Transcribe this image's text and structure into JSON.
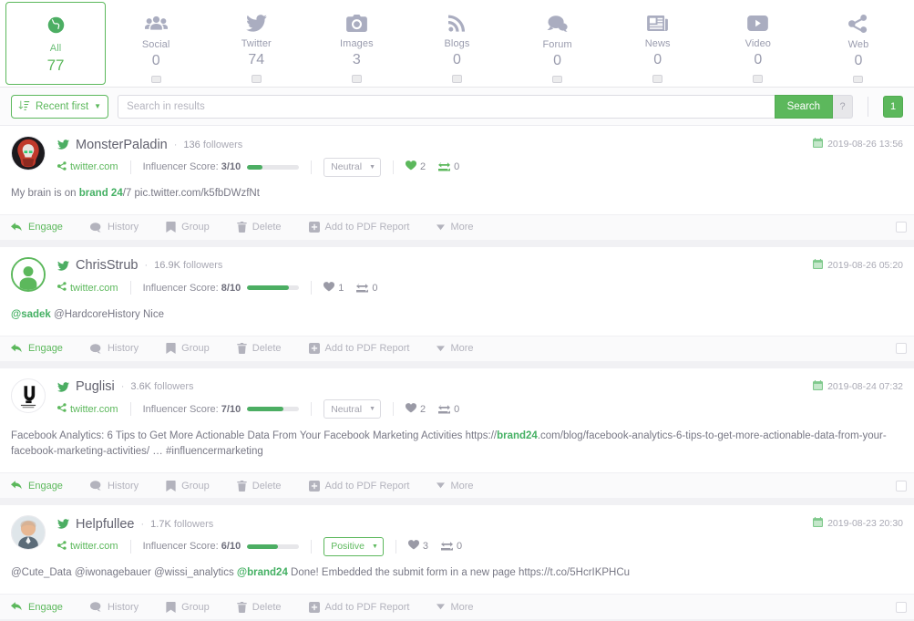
{
  "sources": {
    "items": [
      {
        "label": "All",
        "count": "77",
        "icon": "globe-icon",
        "active": true,
        "checkbox": false
      },
      {
        "label": "Social",
        "count": "0",
        "icon": "users-icon",
        "active": false,
        "checkbox": true
      },
      {
        "label": "Twitter",
        "count": "74",
        "icon": "twitter-icon",
        "active": false,
        "checkbox": true
      },
      {
        "label": "Images",
        "count": "3",
        "icon": "camera-icon",
        "active": false,
        "checkbox": true
      },
      {
        "label": "Blogs",
        "count": "0",
        "icon": "rss-icon",
        "active": false,
        "checkbox": true
      },
      {
        "label": "Forum",
        "count": "0",
        "icon": "comment-icon",
        "active": false,
        "checkbox": true
      },
      {
        "label": "News",
        "count": "0",
        "icon": "news-icon",
        "active": false,
        "checkbox": true
      },
      {
        "label": "Video",
        "count": "0",
        "icon": "video-icon",
        "active": false,
        "checkbox": true
      },
      {
        "label": "Web",
        "count": "0",
        "icon": "share-icon",
        "active": false,
        "checkbox": true
      }
    ]
  },
  "toolbar": {
    "sort_label": "Recent first",
    "search_placeholder": "Search in results",
    "search_value": "",
    "search_button": "Search",
    "help_button": "?",
    "page_button": "1"
  },
  "actions": {
    "engage": "Engage",
    "history": "History",
    "group": "Group",
    "delete": "Delete",
    "pdf": "Add to PDF Report",
    "more": "More"
  },
  "labels": {
    "source_domain": "twitter.com",
    "score_prefix": "Influencer Score:",
    "followers_suffix": "followers",
    "separator_dot": "·"
  },
  "results": [
    {
      "author": "MonsterPaladin",
      "followers": "136",
      "score_text": "3/10",
      "score_pct": 30,
      "sentiment": "Neutral",
      "sentiment_positive": false,
      "likes": "2",
      "retweets": "0",
      "likes_active": true,
      "date": "2019-08-26 13:56",
      "avatar_type": "image-red",
      "text_parts": [
        {
          "t": "My brain is on ",
          "style": "plain"
        },
        {
          "t": "brand 24",
          "style": "hl"
        },
        {
          "t": "/7 pic.twitter.com/k5fbDWzfNt",
          "style": "plain"
        }
      ]
    },
    {
      "author": "ChrisStrub",
      "followers": "16.9K",
      "score_text": "8/10",
      "score_pct": 80,
      "sentiment": null,
      "sentiment_positive": false,
      "likes": "1",
      "retweets": "0",
      "likes_active": false,
      "date": "2019-08-26 05:20",
      "avatar_type": "placeholder",
      "text_parts": [
        {
          "t": "@sadek",
          "style": "mention"
        },
        {
          "t": " @HardcoreHistory Nice",
          "style": "plain"
        }
      ]
    },
    {
      "author": "Puglisi",
      "followers": "3.6K",
      "score_text": "7/10",
      "score_pct": 70,
      "sentiment": "Neutral",
      "sentiment_positive": false,
      "likes": "2",
      "retweets": "0",
      "likes_active": false,
      "date": "2019-08-24 07:32",
      "avatar_type": "image-logo",
      "text_parts": [
        {
          "t": "Facebook Analytics: 6 Tips to Get More Actionable Data From Your Facebook Marketing Activities https://",
          "style": "plain"
        },
        {
          "t": "brand24",
          "style": "hl"
        },
        {
          "t": ".com/blog/facebook-analytics-6-tips-to-get-more-actionable-data-from-your-facebook-marketing-activities/ … #influencermarketing",
          "style": "plain"
        }
      ]
    },
    {
      "author": "Helpfullee",
      "followers": "1.7K",
      "score_text": "6/10",
      "score_pct": 60,
      "sentiment": "Positive",
      "sentiment_positive": true,
      "likes": "3",
      "retweets": "0",
      "likes_active": false,
      "date": "2019-08-23 20:30",
      "avatar_type": "image-person",
      "text_parts": [
        {
          "t": "@Cute_Data @iwonagebauer @wissi_analytics ",
          "style": "plain"
        },
        {
          "t": "@brand24",
          "style": "mention"
        },
        {
          "t": " Done! Embedded the submit form in a new page https://t.co/5HcrIKPHCu",
          "style": "plain"
        }
      ]
    }
  ],
  "colors": {
    "accent": "#5cb85c",
    "muted": "#a9a9b4",
    "text": "#787885"
  }
}
